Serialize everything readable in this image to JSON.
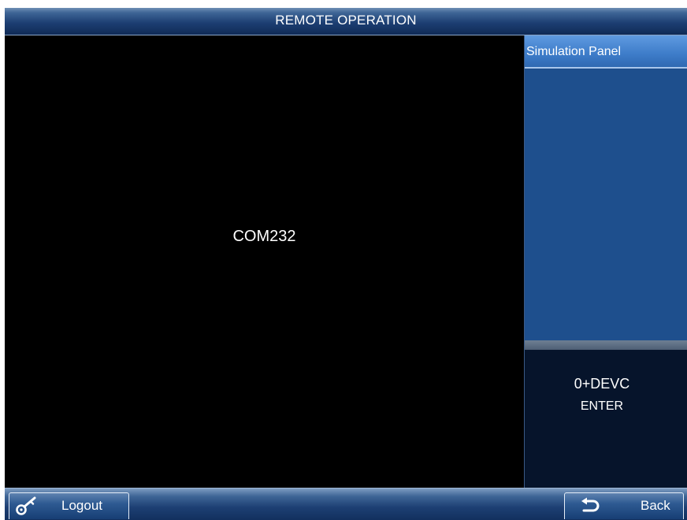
{
  "window": {
    "title": "REMOTE OPERATION"
  },
  "display": {
    "text": "COM232"
  },
  "side_panel": {
    "header": "Simulation Panel",
    "info_line1": "0+DEVC",
    "info_line2": "ENTER"
  },
  "footer": {
    "logout_label": "Logout",
    "logout_icon": "key-icon",
    "back_label": "Back",
    "back_icon": "return-arrow-icon"
  },
  "colors": {
    "panel_header": "#3d7cc9",
    "panel_body": "#1e4f8d",
    "display_bg": "#000000",
    "info_bg": "#06142b"
  }
}
